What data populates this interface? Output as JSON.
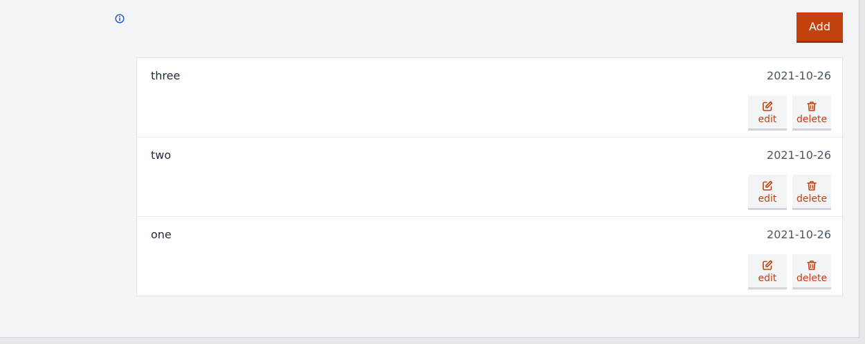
{
  "toolbar": {
    "info_icon": "info-circle-icon",
    "add_label": "Add"
  },
  "colors": {
    "accent": "#c2410c",
    "info": "#1d4ed8"
  },
  "items": [
    {
      "name": "three",
      "date": "2021-10-26",
      "edit_label": "edit",
      "delete_label": "delete"
    },
    {
      "name": "two",
      "date": "2021-10-26",
      "edit_label": "edit",
      "delete_label": "delete"
    },
    {
      "name": "one",
      "date": "2021-10-26",
      "edit_label": "edit",
      "delete_label": "delete"
    }
  ]
}
